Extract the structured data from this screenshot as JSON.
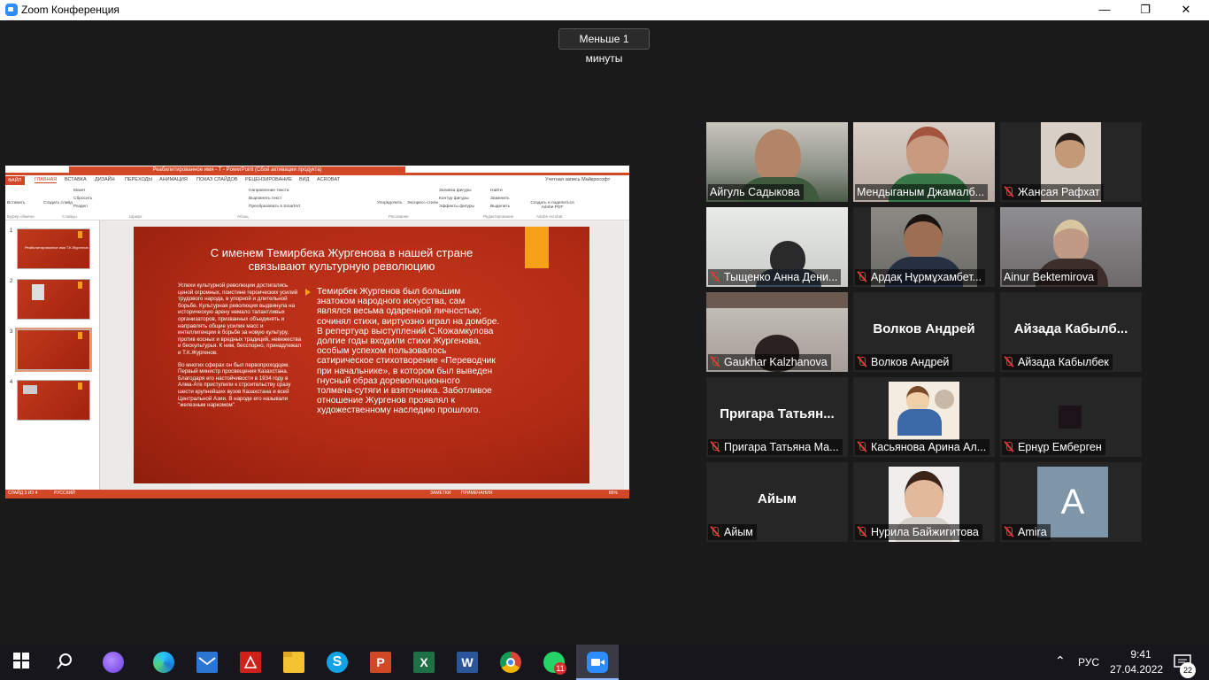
{
  "window": {
    "title": "Zoom Конференция",
    "minimize": "—",
    "restore": "❐",
    "close": "✕"
  },
  "timer": "Меньше 1 минуты",
  "powerpoint": {
    "doc_title": "Реабилитированное имя - T - PowerPoint (Сбой активации продукта)",
    "account": "Учетная запись Майкрософт",
    "tabs": [
      "ФАЙЛ",
      "ГЛАВНАЯ",
      "ВСТАВКА",
      "ДИЗАЙН",
      "ПЕРЕХОДЫ",
      "АНИМАЦИЯ",
      "ПОКАЗ СЛАЙДОВ",
      "РЕЦЕНЗИРОВАНИЕ",
      "ВИД",
      "ACROBAT"
    ],
    "ribbon": {
      "paste": "Вставить",
      "create_slide": "Создать слайд",
      "layout": "Макет",
      "reset": "Сбросить",
      "section": "Раздел",
      "text_direction": "Направление текста",
      "align_text": "Выровнять текст",
      "convert_smartart": "Преобразовать в SmartArt",
      "arrange": "Упорядочить",
      "quick_styles": "Экспресс-стили",
      "shape_fill": "Заливка фигуры",
      "shape_outline": "Контур фигуры",
      "shape_effects": "Эффекты фигуры",
      "find": "Найти",
      "replace": "Заменить",
      "select": "Выделить",
      "create_pdf": "Создать и поделиться Adobe PDF",
      "groups": [
        "Буфер обмена",
        "Слайды",
        "Шрифт",
        "Абзац",
        "Рисование",
        "Редактирование",
        "Adobe Acrobat"
      ]
    },
    "thumbnails": [
      {
        "num": "1",
        "text": "Реабилитированное имя Т.К.Жургенов"
      },
      {
        "num": "2",
        "text": ""
      },
      {
        "num": "3",
        "text": ""
      },
      {
        "num": "4",
        "text": ""
      }
    ],
    "slide": {
      "title": "С именем Темирбека Жургенова в нашей стране связывают культурную революцию",
      "left_p1": "Успехи культурной революции достигались ценой огромных, поистине героических усилий трудового народа, в упорной и длительной борьбе. Культурная революция выдвинула на историческую арену немало талантливых организаторов, призванных объединять и направлять общие усилия масс и интеллигенции в борьбе за новую культуру, против косных и вредных традиций, невежества и бескультурья. К ним, бесспорно, принадлежал и Т.К.Жургенов.",
      "left_p2": "Во многих сферах он был первопроходцем. Первый министр просвещения Казахстана. Благодаря его настойчивости в 1934 году в Алма-Ате приступили к строительству сразу шести крупнейших вузов Казахстана и всей Центральной Азии. В народе его называли \"железным наркомом\".",
      "right": "Темирбек Жургенов был большим знатоком народного искусства, сам являлся весьма одаренной личностью; сочинял стихи, виртуозно играл на домбре. В репертуар выступлений С.Кожамкулова долгие годы входили стихи Жургенова, особым успехом пользовалось сатирическое стихотворение «Переводчик при начальнике», в котором был выведен гнусный образ дореволюционного толмача-сутяги и взяточника. Заботливое отношение Жургенов проявлял к художественному наследию прошлого."
    },
    "status": {
      "slide": "СЛАЙД 3 ИЗ 4",
      "lang": "РУССКИЙ",
      "notes": "ЗАМЕТКИ",
      "comments": "ПРИМЕЧАНИЯ",
      "zoom": "86%"
    }
  },
  "participants": [
    {
      "name": "Айгуль Садыкова",
      "muted": false,
      "video": true
    },
    {
      "name": "Мендыганым Джамалб...",
      "muted": false,
      "video": true
    },
    {
      "name": "Жансая Рафхат",
      "muted": true,
      "video": true
    },
    {
      "name": "Тыщенко Анна Дени...",
      "muted": true,
      "video": true
    },
    {
      "name": "Ардақ Нұрмұхамбет...",
      "muted": true,
      "video": true
    },
    {
      "name": "Ainur Bektemirova",
      "muted": false,
      "video": true,
      "active": true
    },
    {
      "name": "Gaukhar Kalzhanova",
      "muted": true,
      "video": true
    },
    {
      "name": "Волков Андрей",
      "muted": true,
      "video": false,
      "center": "Волков Андрей"
    },
    {
      "name": "Айзада Кабылбек",
      "muted": true,
      "video": false,
      "center": "Айзада Кабылб..."
    },
    {
      "name": "Пригара Татьяна Ма...",
      "muted": true,
      "video": false,
      "center": "Пригара Татьян..."
    },
    {
      "name": "Касьянова Арина Ал...",
      "muted": true,
      "video": true
    },
    {
      "name": "Ернұр Емберген",
      "muted": true,
      "video": false
    },
    {
      "name": "Айым",
      "muted": true,
      "video": false,
      "center": "Айым"
    },
    {
      "name": "Нурила Байжигитова",
      "muted": true,
      "video": true
    },
    {
      "name": "Amira",
      "muted": true,
      "video": false,
      "avatar": "A"
    }
  ],
  "taskbar": {
    "apps": [
      "start",
      "search",
      "alice",
      "edge",
      "mail",
      "acrobat",
      "explorer",
      "skype",
      "powerpoint",
      "excel",
      "word",
      "chrome",
      "whatsapp",
      "zoom"
    ],
    "whatsapp_badge": "11",
    "lang": "РУС",
    "time": "9:41",
    "date": "27.04.2022",
    "notifications": "22"
  },
  "colors": {
    "accent_ppt": "#d24726",
    "slide_bg": "#b02a14",
    "slide_accent": "#f5a017",
    "active_speaker": "#c8e06a",
    "zoom_blue": "#2d8cff"
  }
}
